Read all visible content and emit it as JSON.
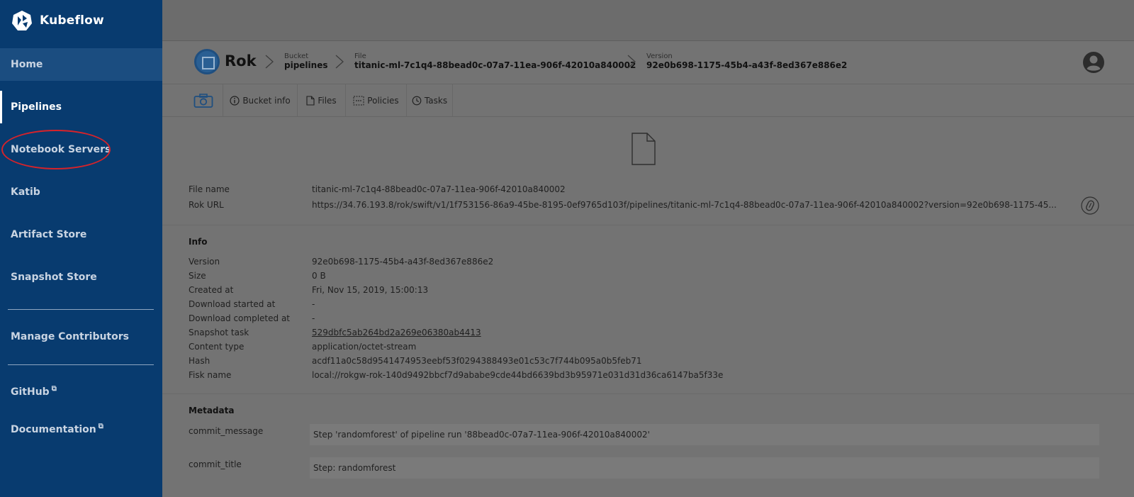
{
  "sidebar": {
    "brand": "Kubeflow",
    "items": [
      {
        "label": "Home"
      },
      {
        "label": "Pipelines"
      },
      {
        "label": "Notebook Servers"
      },
      {
        "label": "Katib"
      },
      {
        "label": "Artifact Store"
      },
      {
        "label": "Snapshot Store"
      },
      {
        "label": "Manage Contributors"
      },
      {
        "label": "GitHub"
      },
      {
        "label": "Documentation"
      }
    ],
    "external_icon": "⧉"
  },
  "header": {
    "app_title": "Rok",
    "crumbs": [
      {
        "label": "Bucket",
        "value": "pipelines"
      },
      {
        "label": "File",
        "value": "titanic-ml-7c1q4-88bead0c-07a7-11ea-906f-42010a840002"
      },
      {
        "label": "Version",
        "value": "92e0b698-1175-45b4-a43f-8ed367e886e2"
      }
    ]
  },
  "toolbar": {
    "items": [
      {
        "label": "Bucket info",
        "icon": "info-icon"
      },
      {
        "label": "Files",
        "icon": "file-icon"
      },
      {
        "label": "Policies",
        "icon": "policy-icon"
      },
      {
        "label": "Tasks",
        "icon": "clock-icon"
      }
    ]
  },
  "file": {
    "name_label": "File name",
    "name_value": "titanic-ml-7c1q4-88bead0c-07a7-11ea-906f-42010a840002",
    "url_label": "Rok URL",
    "url_value": "https://34.76.193.8/rok/swift/v1/1f753156-86a9-45be-8195-0ef9765d103f/pipelines/titanic-ml-7c1q4-88bead0c-07a7-11ea-906f-42010a840002?version=92e0b698-1175-45..."
  },
  "info": {
    "title": "Info",
    "rows": [
      {
        "key": "Version",
        "value": "92e0b698-1175-45b4-a43f-8ed367e886e2"
      },
      {
        "key": "Size",
        "value": "0 B"
      },
      {
        "key": "Created at",
        "value": "Fri, Nov 15, 2019, 15:00:13"
      },
      {
        "key": "Download started at",
        "value": "-"
      },
      {
        "key": "Download completed at",
        "value": "-"
      },
      {
        "key": "Snapshot task",
        "value": "529dbfc5ab264bd2a269e06380ab4413"
      },
      {
        "key": "Content type",
        "value": "application/octet-stream"
      },
      {
        "key": "Hash",
        "value": "acdf11a0c58d9541474953eebf53f0294388493e01c53c7f744b095a0b5feb71"
      },
      {
        "key": "Fisk name",
        "value": "local://rokgw-rok-140d9492bbcf7d9ababe9cde44bd6639bd3b95971e031d31d36ca6147ba5f33e"
      }
    ]
  },
  "metadata": {
    "title": "Metadata",
    "rows": [
      {
        "key": "commit_message",
        "value": "Step 'randomforest' of pipeline run '88bead0c-07a7-11ea-906f-42010a840002'"
      },
      {
        "key": "commit_title",
        "value": "Step: randomforest"
      }
    ]
  },
  "colors": {
    "sidebar": "#083b6f",
    "sidebar_active": "#1b4d80",
    "overlay": "#737373",
    "highlight": "#d6232a"
  }
}
